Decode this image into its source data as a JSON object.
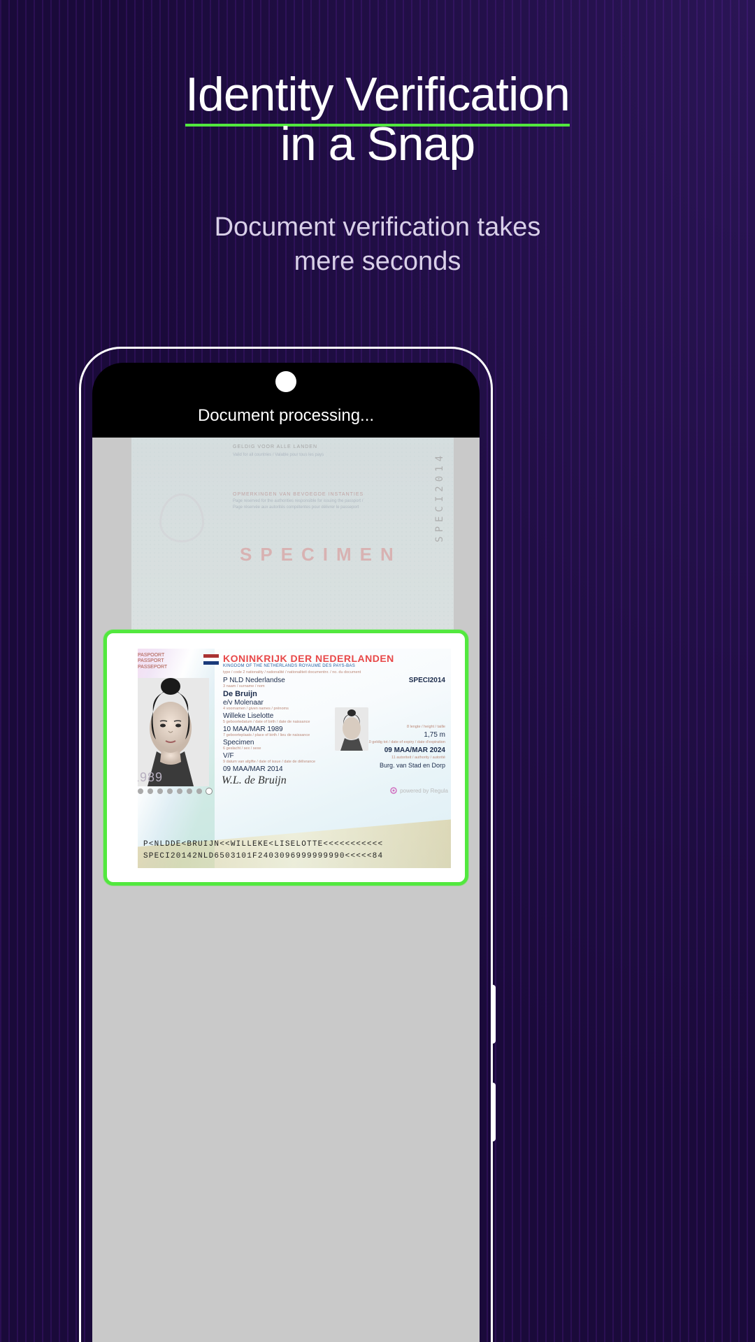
{
  "hero": {
    "title_underlined": "Identity Verification",
    "title_rest": "in a Snap",
    "subtitle_l1": "Document verification takes",
    "subtitle_l2": "mere seconds"
  },
  "phone": {
    "processing_label": "Document processing..."
  },
  "doc_top": {
    "valid_label": "GELDIG VOOR ALLE LANDEN",
    "valid_line": "Valid for all countries / Valable pour tous les pays",
    "remarks_label": "OPMERKINGEN VAN BEVOEGDE INSTANTIES",
    "remarks_line1": "Page reserved for the authorities responsible for issuing the passport /",
    "remarks_line2": "Page réservée aux autorités compétentes pour délivrer le passeport",
    "specimen": "SPECIMEN",
    "vertical": "SPECI2014"
  },
  "passport": {
    "doc_labels": "PASPOORT\nPASSPORT\nPASSEPORT",
    "country_title": "KONINKRIJK DER NEDERLANDEN",
    "country_subtitle": "KINGDOM OF THE NETHERLANDS                    ROYAUME DES PAYS-BAS",
    "doc_no": "SPECI2014",
    "type_code_nat": "P    NLD Nederlandse",
    "surname": "De Bruijn",
    "spouse": "e/v Molenaar",
    "given_names": "Willeke Liselotte",
    "dob": "10 MAA/MAR 1989",
    "pob": "Specimen",
    "sex": "V/F",
    "issue_date": "09 MAA/MAR 2014",
    "height": "1,75 m",
    "expiry": "09 MAA/MAR 2024",
    "authority": "Burg. van Stad en Dorp",
    "photo_year": "1989",
    "signature": "W.L. de Bruijn",
    "powered": "powered by Regula",
    "mrz_l1": "P<NLDDE<BRUIJN<<WILLEKE<LISELOTTE<<<<<<<<<<<",
    "mrz_l2": "SPECI20142NLD6503101F2403096999999990<<<<<84"
  }
}
